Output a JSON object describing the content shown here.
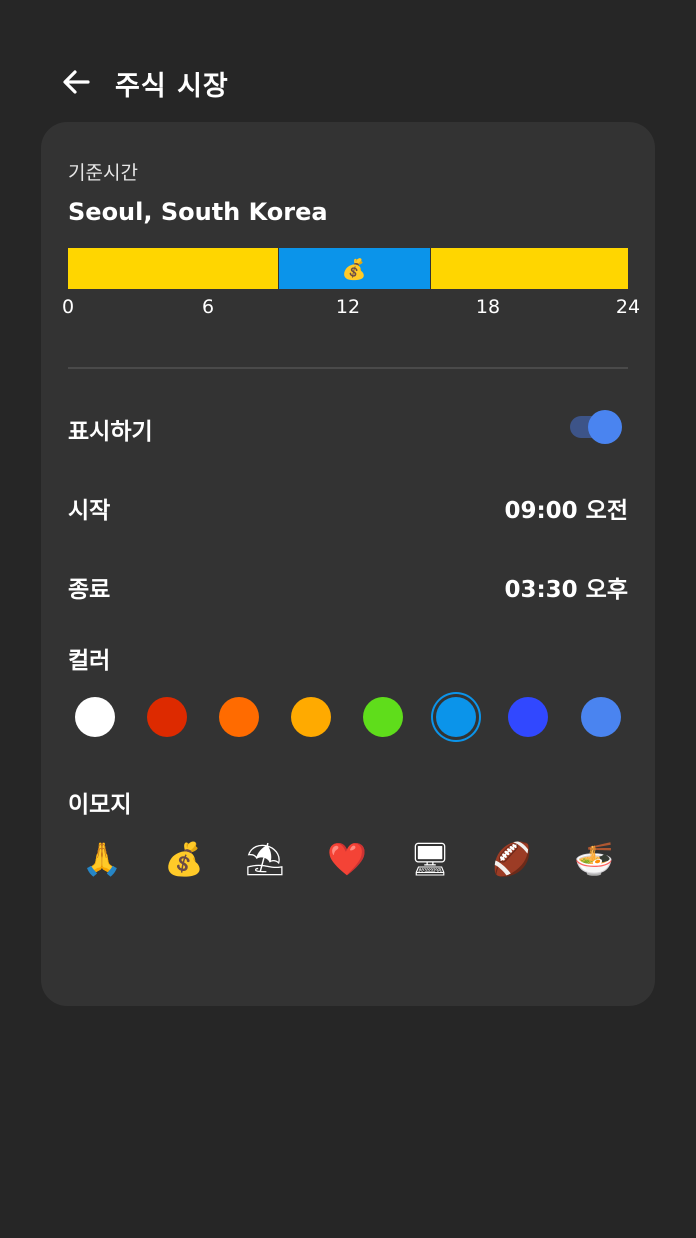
{
  "header": {
    "back_icon": "arrow-left-icon",
    "title": "주식 시장"
  },
  "timezone": {
    "label": "기준시간",
    "city": "Seoul, South Korea"
  },
  "timeline": {
    "segments": [
      {
        "start": 0,
        "end": 9,
        "color": "#ffd600",
        "emoji": ""
      },
      {
        "start": 9,
        "end": 15.5,
        "color": "#0b94ea",
        "emoji": "💰"
      },
      {
        "start": 15.5,
        "end": 24,
        "color": "#ffd600",
        "emoji": ""
      }
    ],
    "ticks": [
      "0",
      "6",
      "12",
      "18",
      "24"
    ]
  },
  "settings": {
    "show_label": "표시하기",
    "show_enabled": true,
    "start_label": "시작",
    "start_value": "09:00 오전",
    "end_label": "종료",
    "end_value": "03:30 오후"
  },
  "color": {
    "label": "컬러",
    "options": [
      "#ffffff",
      "#dd2a00",
      "#ff6b00",
      "#ffaa00",
      "#5fdd1b",
      "#0b94ea",
      "#3148ff",
      "#4a84f0"
    ],
    "selected_index": 5
  },
  "emoji": {
    "label": "이모지",
    "options": [
      "🙏",
      "💰",
      "⛱",
      "❤️",
      "🖥",
      "🏈",
      "🍜"
    ]
  }
}
